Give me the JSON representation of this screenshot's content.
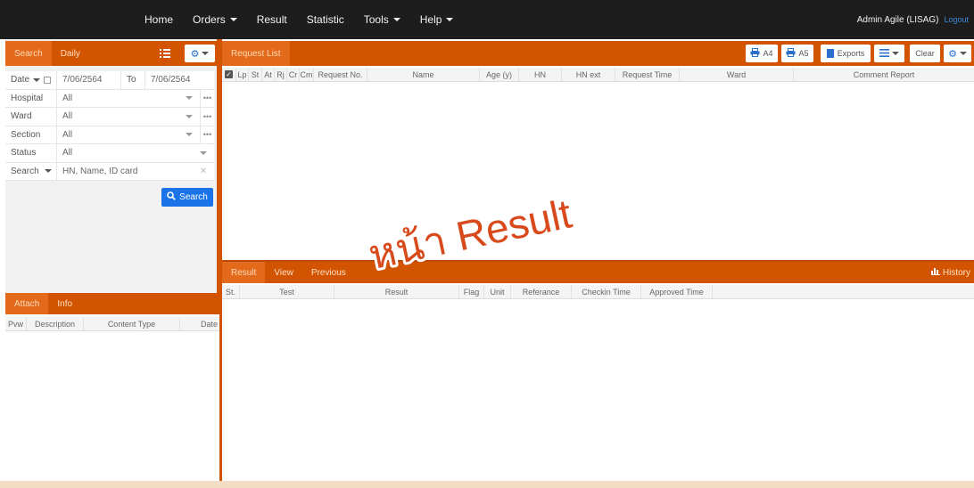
{
  "nav": {
    "items": [
      {
        "label": "Home",
        "dropdown": false
      },
      {
        "label": "Orders",
        "dropdown": true
      },
      {
        "label": "Result",
        "dropdown": false
      },
      {
        "label": "Statistic",
        "dropdown": false
      },
      {
        "label": "Tools",
        "dropdown": true
      },
      {
        "label": "Help",
        "dropdown": true
      }
    ],
    "user": "Admin Agile (LISAG)",
    "logout": "Logout"
  },
  "search_panel": {
    "tabs": [
      "Search",
      "Daily"
    ],
    "date_label": "Date",
    "date_from": "7/06/2564",
    "to_label": "To",
    "date_to": "7/06/2564",
    "hospital_label": "Hospital",
    "hospital_value": "All",
    "ward_label": "Ward",
    "ward_value": "All",
    "section_label": "Section",
    "section_value": "All",
    "status_label": "Status",
    "status_value": "All",
    "search_label": "Search",
    "search_placeholder": "HN, Name, ID card",
    "search_button": "Search"
  },
  "attach_panel": {
    "tabs": [
      "Attach",
      "Info"
    ],
    "columns": [
      "Pvw",
      "Description",
      "Content Type",
      "Date"
    ]
  },
  "request_list": {
    "tab": "Request List",
    "buttons": {
      "a4": "A4",
      "a5": "A5",
      "exports": "Exports",
      "clear": "Clear"
    },
    "columns": [
      "Lp",
      "St",
      "At",
      "Rj",
      "Cr",
      "Cm",
      "Request No.",
      "Name",
      "Age (y)",
      "HN",
      "HN ext",
      "Request Time",
      "Ward",
      "Comment Report"
    ]
  },
  "result_panel": {
    "tabs": [
      "Result",
      "View",
      "Previous"
    ],
    "history": "History",
    "columns": [
      "St.",
      "Test",
      "Result",
      "Flag",
      "Unit",
      "Referance",
      "Checkin Time",
      "Approved Time"
    ]
  },
  "watermark": "หน้า Result",
  "colors": {
    "accent": "#d35400",
    "topbar": "#1d1d1d",
    "primary_button": "#1a73e8",
    "watermark": "#d84a1b"
  }
}
